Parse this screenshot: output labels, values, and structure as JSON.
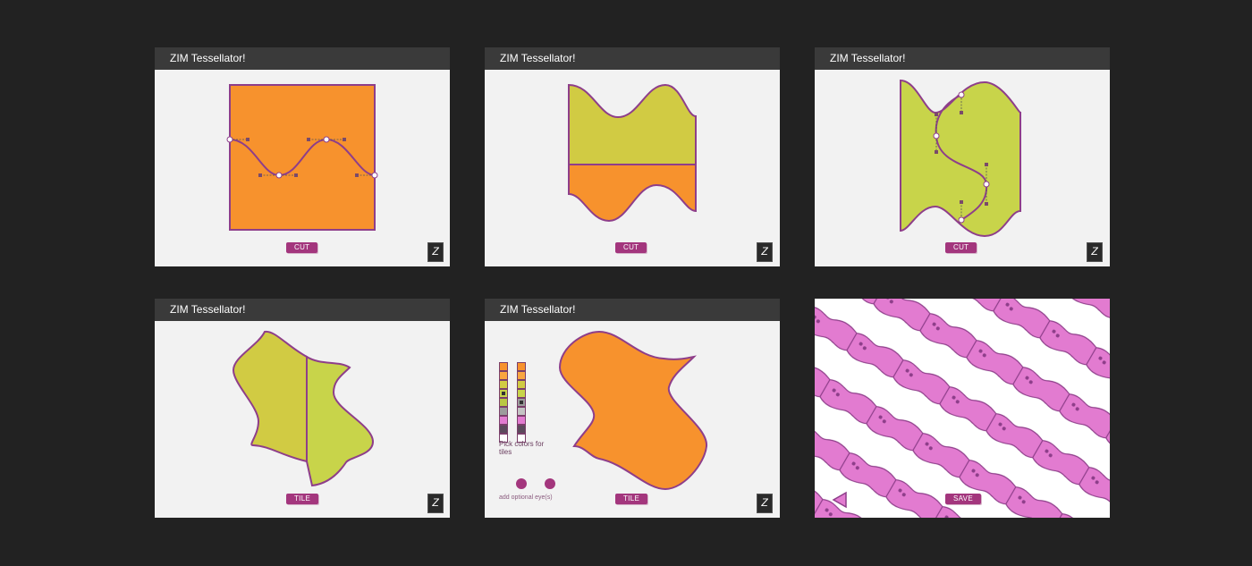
{
  "app_title": "ZIM Tessellator!",
  "colors": {
    "background": "#222222",
    "orange": "#f7922d",
    "yellow_green": "#c8d44a",
    "olive_yellow": "#d1cb43",
    "outline": "#8e3e8a",
    "button": "#a3367d",
    "tile_pink": "#e27bd0"
  },
  "panels": [
    {
      "title": "ZIM Tessellator!",
      "button_label": "CUT",
      "logo": "Z"
    },
    {
      "title": "ZIM Tessellator!",
      "button_label": "CUT",
      "logo": "Z"
    },
    {
      "title": "ZIM Tessellator!",
      "button_label": "CUT",
      "logo": "Z"
    },
    {
      "title": "ZIM Tessellator!",
      "button_label": "TILE",
      "logo": "Z"
    },
    {
      "title": "ZIM Tessellator!",
      "button_label": "TILE",
      "logo": "Z",
      "palette_caption": "Pick colors for tiles",
      "eyes_caption": "add optional eye(s)",
      "palette_colors": [
        "#f7922d",
        "#f7922d",
        "#d1cb43",
        "#c8d44a",
        "#c8d44a",
        "#9c9c9c",
        "#e27bd0",
        "#5c4a5c",
        "#ffffff"
      ]
    },
    {
      "button_label": "SAVE",
      "back_icon": "triangle-back-icon"
    }
  ]
}
